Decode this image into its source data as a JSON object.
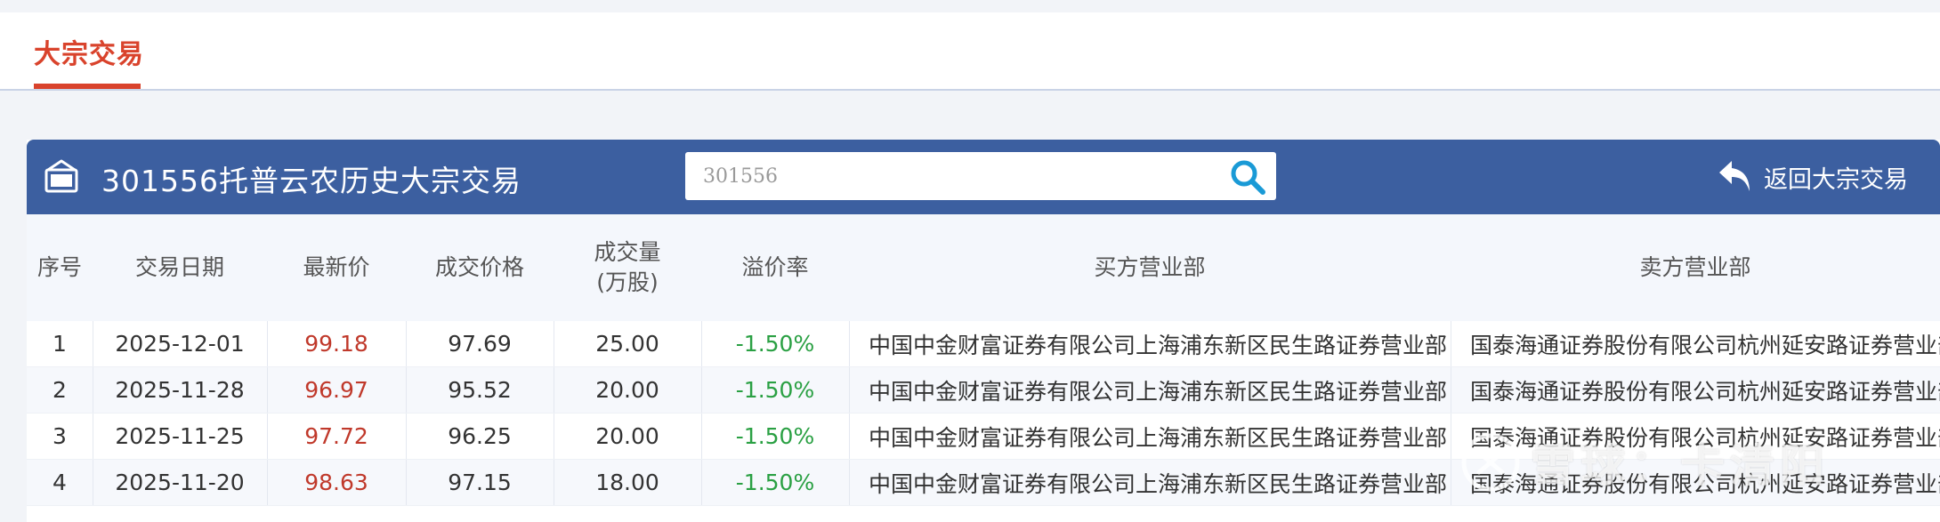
{
  "tab": {
    "label": "大宗交易"
  },
  "header": {
    "title": "301556托普云农历史大宗交易",
    "search_placeholder": "301556",
    "back_label": "返回大宗交易"
  },
  "table": {
    "headers": {
      "index": "序号",
      "date": "交易日期",
      "latest": "最新价",
      "deal_price": "成交价格",
      "volume_line1": "成交量",
      "volume_line2": "(万股)",
      "premium": "溢价率",
      "buyer": "买方营业部",
      "seller": "卖方营业部"
    },
    "rows": [
      {
        "index": "1",
        "date": "2025-12-01",
        "latest": "99.18",
        "deal_price": "97.69",
        "volume": "25.00",
        "premium": "-1.50%",
        "buyer": "中国中金财富证券有限公司上海浦东新区民生路证券营业部",
        "seller": "国泰海通证券股份有限公司杭州延安路证券营业部"
      },
      {
        "index": "2",
        "date": "2025-11-28",
        "latest": "96.97",
        "deal_price": "95.52",
        "volume": "20.00",
        "premium": "-1.50%",
        "buyer": "中国中金财富证券有限公司上海浦东新区民生路证券营业部",
        "seller": "国泰海通证券股份有限公司杭州延安路证券营业部"
      },
      {
        "index": "3",
        "date": "2025-11-25",
        "latest": "97.72",
        "deal_price": "96.25",
        "volume": "20.00",
        "premium": "-1.50%",
        "buyer": "中国中金财富证券有限公司上海浦东新区民生路证券营业部",
        "seller": "国泰海通证券股份有限公司杭州延安路证券营业部"
      },
      {
        "index": "4",
        "date": "2025-11-20",
        "latest": "98.63",
        "deal_price": "97.15",
        "volume": "18.00",
        "premium": "-1.50%",
        "buyer": "中国中金财富证券有限公司上海浦东新区民生路证券营业部",
        "seller": "国泰海通证券股份有限公司杭州延安路证券营业部"
      }
    ]
  },
  "colors": {
    "accent_red": "#d9432c",
    "header_blue": "#3c5fa0",
    "price_red": "#c0392b",
    "premium_green": "#2aa043"
  },
  "watermark": {
    "text": "雪球：卡清阳"
  }
}
